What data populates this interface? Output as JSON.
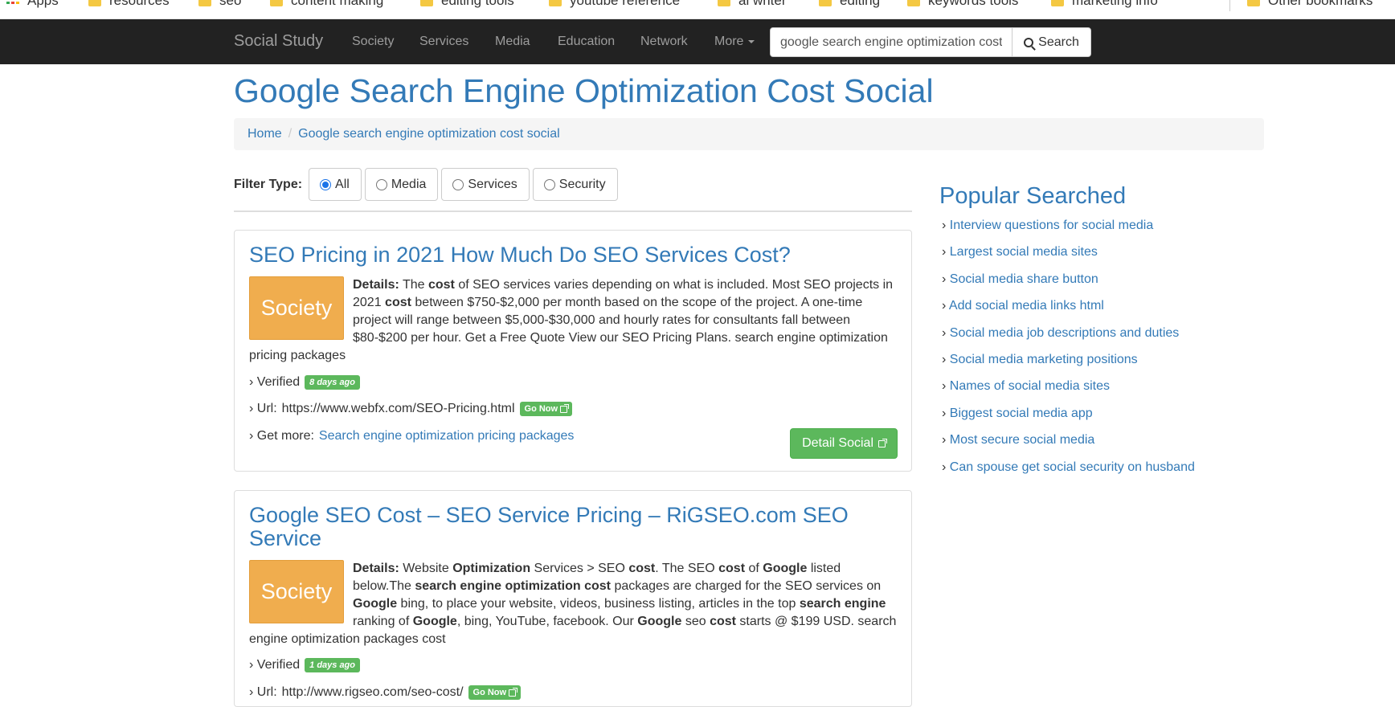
{
  "bookmarks": {
    "apps_label": "Apps",
    "items": [
      "resources",
      "seo",
      "content making",
      "editing tools",
      "youtube reference",
      "ai writer",
      "editing",
      "keywords tools",
      "marketing info"
    ],
    "other_label": "Other bookmarks"
  },
  "navbar": {
    "brand": "Social Study",
    "items": [
      "Society",
      "Services",
      "Media",
      "Education",
      "Network"
    ],
    "more_label": "More",
    "search_value": "google search engine optimization cost",
    "search_button": "Search"
  },
  "page": {
    "title": "Google Search Engine Optimization Cost Social"
  },
  "breadcrumb": {
    "home": "Home",
    "sep": "/",
    "current": "Google search engine optimization cost social"
  },
  "filter": {
    "label": "Filter Type:",
    "options": [
      "All",
      "Media",
      "Services",
      "Security"
    ],
    "selected": "All"
  },
  "results": [
    {
      "title": "SEO Pricing in 2021 How Much Do SEO Services Cost?",
      "category": "Society",
      "details_label": "Details:",
      "verified_label": "› Verified",
      "verified_age": "8 days ago",
      "url_label": "› Url:",
      "url": "https://www.webfx.com/SEO-Pricing.html",
      "go_now": "Go Now",
      "get_more_label": "› Get more:",
      "get_more_link": "Search engine optimization pricing packages",
      "detail_button": "Detail Social"
    },
    {
      "title": "Google SEO Cost – SEO Service Pricing – RiGSEO.com SEO Service",
      "category": "Society",
      "details_label": "Details:",
      "verified_label": "› Verified",
      "verified_age": "1 days ago",
      "url_label": "› Url:",
      "url": "http://www.rigseo.com/seo-cost/",
      "go_now": "Go Now"
    }
  ],
  "sidebar": {
    "title": "Popular Searched",
    "bullet": "›",
    "items": [
      "Interview questions for social media",
      "Largest social media sites",
      "Social media share button",
      "Add social media links html",
      "Social media job descriptions and duties",
      "Social media marketing positions",
      "Names of social media sites",
      "Biggest social media app",
      "Most secure social media",
      "Can spouse get social security on husband"
    ]
  },
  "colors": {
    "navbar_bg": "#222222",
    "link": "#337ab7",
    "category_badge": "#f0ad4e",
    "success": "#5cb85c"
  }
}
